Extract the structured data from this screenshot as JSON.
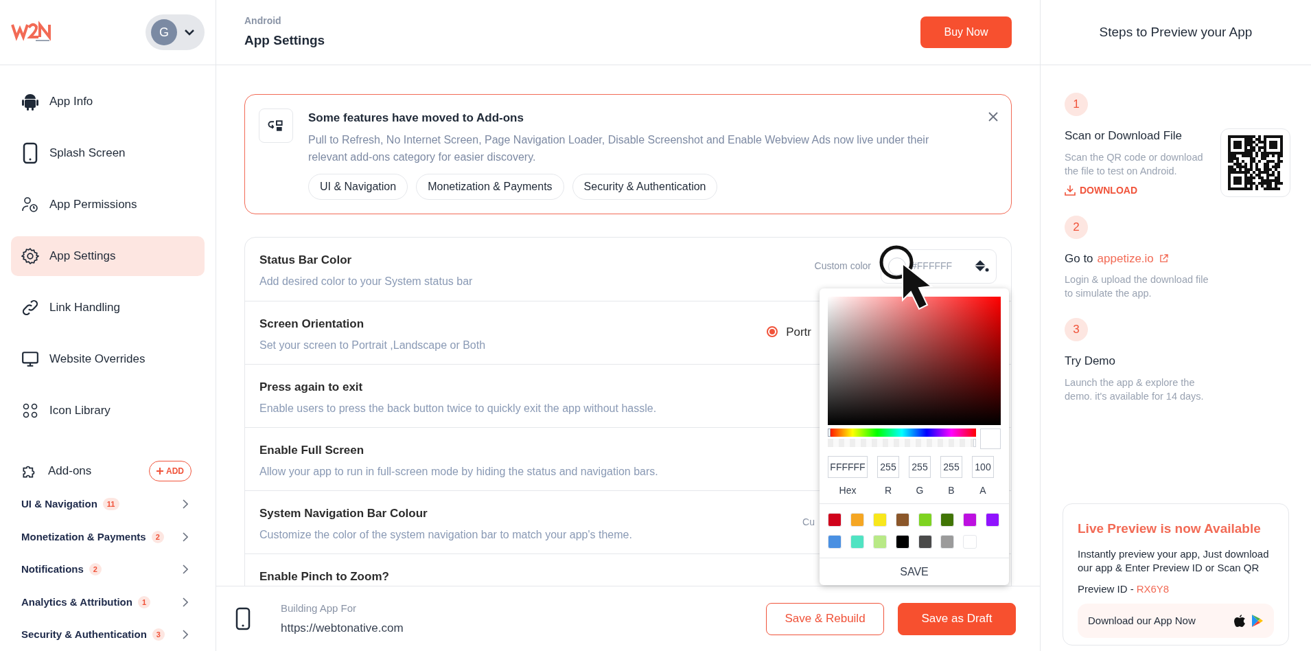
{
  "sidebar": {
    "avatar": "G",
    "items": [
      {
        "label": "App Info",
        "selected": false
      },
      {
        "label": "Splash Screen",
        "selected": false
      },
      {
        "label": "App Permissions",
        "selected": false
      },
      {
        "label": "App Settings",
        "selected": true
      },
      {
        "label": "Link Handling",
        "selected": false
      },
      {
        "label": "Website Overrides",
        "selected": false
      },
      {
        "label": "Icon Library",
        "selected": false
      }
    ],
    "addons": {
      "label": "Add-ons",
      "button": "ADD",
      "categories": [
        {
          "label": "UI & Navigation",
          "count": "11"
        },
        {
          "label": "Monetization & Payments",
          "count": "2"
        },
        {
          "label": "Notifications",
          "count": "2"
        },
        {
          "label": "Analytics & Attribution",
          "count": "1"
        },
        {
          "label": "Security & Authentication",
          "count": "3"
        }
      ]
    }
  },
  "header": {
    "platform": "Android",
    "title": "App Settings",
    "button": "Buy Now"
  },
  "notice": {
    "title": "Some features have moved to Add-ons",
    "text": "Pull to Refresh, No Internet Screen, Page Navigation Loader, Disable Screenshot and Enable Webview Ads now live under their relevant add-ons category for easier discovery.",
    "tags": [
      "UI & Navigation",
      "Monetization & Payments",
      "Security & Authentication"
    ]
  },
  "settings": [
    {
      "title": "Status Bar Color",
      "description": "Add desired color to your System status bar",
      "control": {
        "kind": "color",
        "label": "Custom color",
        "value": "#FFFFFF"
      }
    },
    {
      "title": "Screen Orientation",
      "description": "Set your screen to Portrait ,Landscape or Both",
      "control": {
        "kind": "radio",
        "label": "Portr",
        "selected": true
      }
    },
    {
      "title": "Press again to exit",
      "description": "Enable users to press the back button twice to quickly exit the app without hassle."
    },
    {
      "title": "Enable Full Screen",
      "description": "Allow your app to run in full-screen mode by hiding the status and navigation bars."
    },
    {
      "title": "System Navigation Bar Colour",
      "description": "Customize the color of the system navigation bar to match your app's theme.",
      "control": {
        "kind": "label",
        "label": "Cu"
      }
    },
    {
      "title": "Enable Pinch to Zoom?"
    }
  ],
  "color_picker": {
    "hue": {
      "level": 0
    },
    "alpha": {
      "level": 1
    },
    "fields": [
      {
        "label": "Hex",
        "value": "FFFFFF"
      },
      {
        "label": "R",
        "value": "255"
      },
      {
        "label": "G",
        "value": "255"
      },
      {
        "label": "B",
        "value": "255"
      },
      {
        "label": "A",
        "value": "100"
      }
    ],
    "swatches": [
      {
        "color": "#d0021b"
      },
      {
        "color": "#f5a623"
      },
      {
        "color": "#f8e71c"
      },
      {
        "color": "#8b572a"
      },
      {
        "color": "#7ed321"
      },
      {
        "color": "#417505"
      },
      {
        "color": "#bd10e0"
      },
      {
        "color": "#9013fe"
      },
      {
        "color": "#4a90e2"
      },
      {
        "color": "#50e3c2"
      },
      {
        "color": "#b8e986"
      },
      {
        "color": "#000000"
      },
      {
        "color": "#4a4a4a"
      },
      {
        "color": "#9b9b9b"
      },
      {
        "color": "#ffffff"
      }
    ],
    "button": "SAVE"
  },
  "footer": {
    "label": "Building App For",
    "url": "https://webtonative.com",
    "buttons": [
      {
        "label": "Save & Rebuild",
        "kind": "outline"
      },
      {
        "label": "Save as Draft",
        "kind": "filled"
      }
    ]
  },
  "preview": {
    "title": "Steps to Preview your App",
    "steps": [
      {
        "number": "1",
        "title": "Scan or Download File",
        "description": "Scan the QR code or download the file to test on Android.",
        "action": "DOWNLOAD"
      },
      {
        "number": "2",
        "title": "Go to",
        "link": "appetize.io",
        "description": "Login & upload the download file to simulate the app."
      },
      {
        "number": "3",
        "title": "Try Demo",
        "description": "Launch the app & explore the demo. it's available for 14 days."
      }
    ],
    "live": {
      "title": "Live Preview is now Available",
      "text": "Instantly preview your app, Just download our app & Enter Preview ID or Scan QR",
      "id_label": "Preview ID -",
      "id": "RX6Y8",
      "download": "Download our App Now"
    }
  }
}
